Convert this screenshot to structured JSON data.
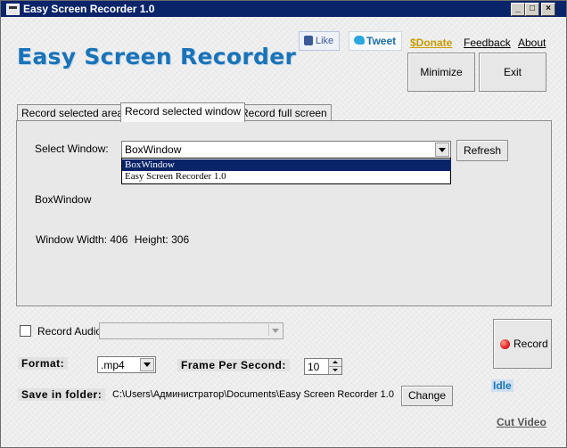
{
  "window": {
    "title": "Easy Screen Recorder 1.0"
  },
  "header": {
    "logo_text": "Easy Screen Recorder",
    "like_label": "Like",
    "tweet_label": "Tweet",
    "donate_label": "$Donate",
    "feedback_label": "Feedback",
    "about_label": "About",
    "minimize_label": "Minimize",
    "exit_label": "Exit"
  },
  "tabs": [
    {
      "label": "Record selected area",
      "active": false
    },
    {
      "label": "Record selected window",
      "active": true
    },
    {
      "label": "Record full screen",
      "active": false
    }
  ],
  "window_tab": {
    "select_label": "Select Window:",
    "selected_value": "BoxWindow",
    "options": [
      "BoxWindow",
      "Easy Screen Recorder 1.0"
    ],
    "refresh_label": "Refresh",
    "window_name": "BoxWindow",
    "width_text": "Window Width: 406",
    "height_text": "Height: 306"
  },
  "audio": {
    "label": "Record Audio",
    "checked": false
  },
  "format": {
    "label": "Format:",
    "value": ".mp4"
  },
  "fps": {
    "label": "Frame Per Second:",
    "value": "10"
  },
  "save": {
    "label": "Save in folder:",
    "path": "C:\\Users\\Администратор\\Documents\\Easy Screen Recorder 1.0",
    "change_label": "Change"
  },
  "record": {
    "label": "Record"
  },
  "status": {
    "text": "Idle"
  },
  "footer": {
    "cut_video_label": "Cut Video"
  },
  "colors": {
    "accent": "#1a73b8",
    "titlebar": "#0a246a",
    "donate": "#c79b00",
    "record_dot": "#e02020"
  }
}
